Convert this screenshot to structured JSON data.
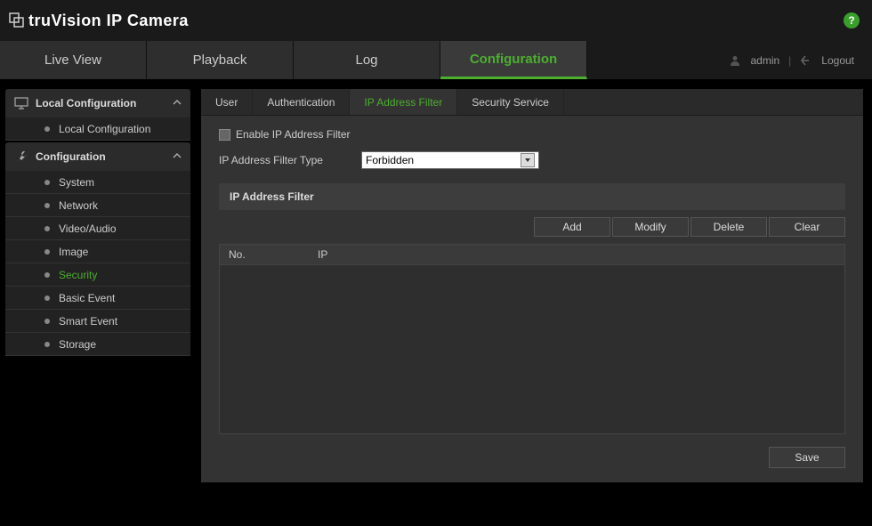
{
  "brand": "truVision  IP Camera",
  "topnav": {
    "items": [
      "Live View",
      "Playback",
      "Log",
      "Configuration"
    ],
    "active_index": 3
  },
  "user": {
    "name": "admin",
    "logout_label": "Logout"
  },
  "sidebar": {
    "sections": [
      {
        "title": "Local Configuration",
        "items": [
          "Local Configuration"
        ],
        "active_index": -1
      },
      {
        "title": "Configuration",
        "items": [
          "System",
          "Network",
          "Video/Audio",
          "Image",
          "Security",
          "Basic Event",
          "Smart Event",
          "Storage"
        ],
        "active_index": 4
      }
    ]
  },
  "tabs": {
    "items": [
      "User",
      "Authentication",
      "IP Address Filter",
      "Security Service"
    ],
    "active_index": 2
  },
  "form": {
    "enable_label": "Enable IP Address Filter",
    "type_label": "IP Address Filter Type",
    "type_value": "Forbidden"
  },
  "filter": {
    "section_title": "IP Address Filter",
    "buttons": {
      "add": "Add",
      "modify": "Modify",
      "delete": "Delete",
      "clear": "Clear"
    },
    "columns": {
      "no": "No.",
      "ip": "IP"
    },
    "rows": []
  },
  "save_label": "Save",
  "help_tooltip": "?"
}
